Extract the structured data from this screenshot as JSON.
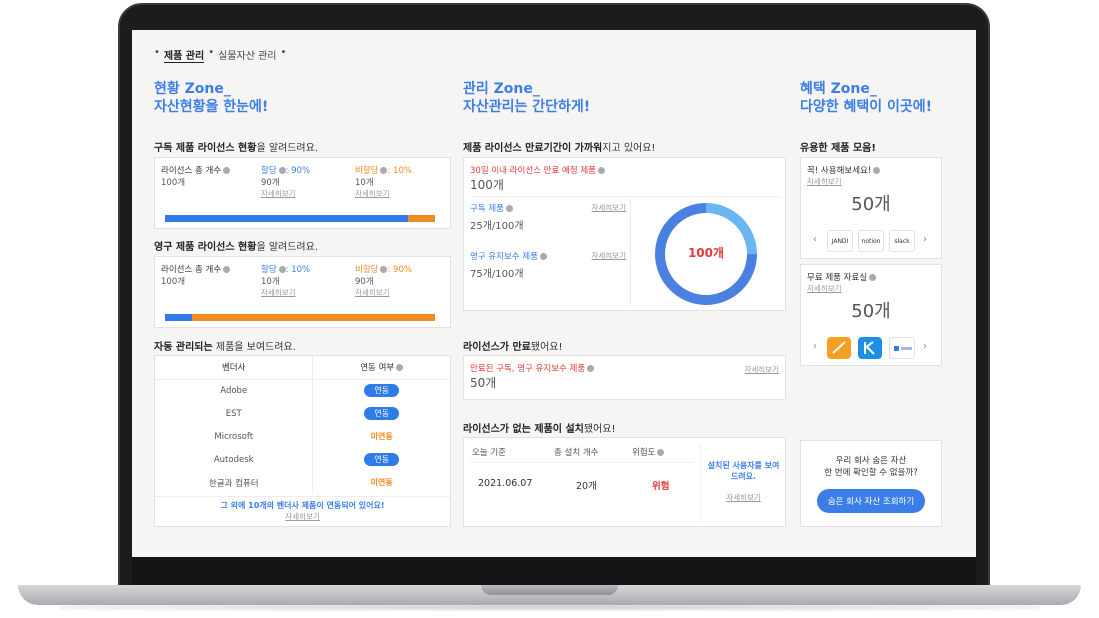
{
  "tabs": [
    "제품 관리",
    "실물자산 관리"
  ],
  "zones": [
    {
      "title": "현황 Zone_",
      "subtitle": "자산현황을 한눈에!"
    },
    {
      "title": "관리 Zone_",
      "subtitle": "자산관리는 간단하게!"
    },
    {
      "title": "혜택 Zone_",
      "subtitle": "다양한 혜택이 이곳에!"
    }
  ],
  "detail_link": "자세히보기",
  "subscription": {
    "title_bold": "구독 제품 라이선스 현황",
    "title_rest": "을 알려드려요.",
    "total_label": "라이선스 총 개수",
    "total_value": "100개",
    "assigned_label": "할당",
    "assigned_pct": ": 90%",
    "assigned_value": "90개",
    "unassigned_label": "비할당",
    "unassigned_pct": ": 10%",
    "unassigned_value": "10개",
    "assigned_fraction": 0.9
  },
  "perpetual": {
    "title_bold": "영구 제품 라이선스 현황",
    "title_rest": "을 알려드려요.",
    "total_label": "라이선스 총 개수",
    "total_value": "100개",
    "assigned_label": "할당",
    "assigned_pct": ": 10%",
    "assigned_value": "10개",
    "unassigned_label": "비할당",
    "unassigned_pct": ": 90%",
    "unassigned_value": "90개",
    "assigned_fraction": 0.1
  },
  "auto": {
    "title_bold": "자동 관리되는",
    "title_rest": " 제품을 보여드려요.",
    "col_vendor": "벤더사",
    "col_link": "연동 여부",
    "rows": [
      {
        "vendor": "Adobe",
        "status": "연동",
        "linked": true
      },
      {
        "vendor": "EST",
        "status": "연동",
        "linked": true
      },
      {
        "vendor": "Microsoft",
        "status": "미연동",
        "linked": false
      },
      {
        "vendor": "Autodesk",
        "status": "연동",
        "linked": true
      },
      {
        "vendor": "한글과 컴퓨터",
        "status": "미연동",
        "linked": false
      }
    ],
    "footer": "그 외에 10개의 벤더사 제품이 연동되어 있어요!"
  },
  "expiring": {
    "title_bold": "제품 라이선스 만료기간이 가까워",
    "title_rest": "지고 있어요!",
    "head_label": "30일 이내 라이선스 만료 예정 제품",
    "head_value": "100개",
    "sub_label": "구독 제품",
    "sub_value": "25개/100개",
    "perm_label": "영구 유지보수 제품",
    "perm_value": "75개/100개",
    "donut_center": "100개",
    "donut_fraction_light": 0.25
  },
  "expired": {
    "title_bold": "라이선스가 만료",
    "title_rest": "됐어요!",
    "label": "만료된 구독, 영구 유지보수 제품",
    "value": "50개"
  },
  "unlicensed": {
    "title_bold": "라이선스가 없는 제품이 설치",
    "title_rest": "됐어요!",
    "col_date": "오늘 기준",
    "col_count": "총 설치 개수",
    "col_risk": "위험도",
    "date": "2021.06.07",
    "count": "20개",
    "risk": "위험",
    "notice": "설치된 사용자를 보여드려요."
  },
  "benefits": {
    "title": "유용한 제품 모음!",
    "try_label": "꼭! 사용해보세요!",
    "try_value": "50개",
    "try_logos": [
      "JANDI",
      "notion",
      "slack"
    ],
    "free_label": "무료 제품 자료실",
    "free_value": "50개",
    "cta_line1": "우리 회사 숨은 자산",
    "cta_line2": "한 번에 확인할 수 없을까?",
    "cta_button": "숨은 회사 자산 조회하기"
  },
  "colors": {
    "accent": "#3b7ee8",
    "orange": "#f08a22",
    "red": "#e23b3b",
    "donut_dark": "#4a80e0",
    "donut_light": "#6ab6f0"
  }
}
